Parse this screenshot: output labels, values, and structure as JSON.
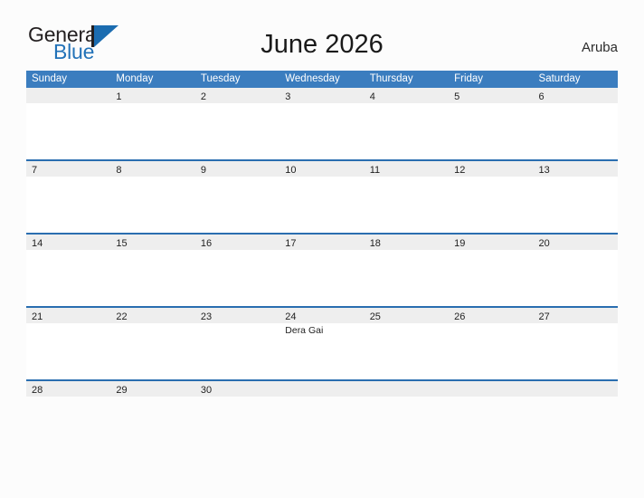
{
  "brand": {
    "name_part1": "General",
    "name_part2": "Blue",
    "mark": "triangle-logo-icon",
    "accent_color": "#1b6cb0"
  },
  "header": {
    "title": "June 2026",
    "region": "Aruba"
  },
  "calendar": {
    "month": "June",
    "year": "2026",
    "header_bg": "#3b7dbf",
    "row_divider_color": "#2a6eb0",
    "daynum_band_color": "#eeeeee",
    "weekdays": [
      "Sunday",
      "Monday",
      "Tuesday",
      "Wednesday",
      "Thursday",
      "Friday",
      "Saturday"
    ],
    "weeks": [
      [
        {
          "date": "",
          "event": ""
        },
        {
          "date": "1",
          "event": ""
        },
        {
          "date": "2",
          "event": ""
        },
        {
          "date": "3",
          "event": ""
        },
        {
          "date": "4",
          "event": ""
        },
        {
          "date": "5",
          "event": ""
        },
        {
          "date": "6",
          "event": ""
        }
      ],
      [
        {
          "date": "7",
          "event": ""
        },
        {
          "date": "8",
          "event": ""
        },
        {
          "date": "9",
          "event": ""
        },
        {
          "date": "10",
          "event": ""
        },
        {
          "date": "11",
          "event": ""
        },
        {
          "date": "12",
          "event": ""
        },
        {
          "date": "13",
          "event": ""
        }
      ],
      [
        {
          "date": "14",
          "event": ""
        },
        {
          "date": "15",
          "event": ""
        },
        {
          "date": "16",
          "event": ""
        },
        {
          "date": "17",
          "event": ""
        },
        {
          "date": "18",
          "event": ""
        },
        {
          "date": "19",
          "event": ""
        },
        {
          "date": "20",
          "event": ""
        }
      ],
      [
        {
          "date": "21",
          "event": ""
        },
        {
          "date": "22",
          "event": ""
        },
        {
          "date": "23",
          "event": ""
        },
        {
          "date": "24",
          "event": "Dera Gai"
        },
        {
          "date": "25",
          "event": ""
        },
        {
          "date": "26",
          "event": ""
        },
        {
          "date": "27",
          "event": ""
        }
      ],
      [
        {
          "date": "28",
          "event": ""
        },
        {
          "date": "29",
          "event": ""
        },
        {
          "date": "30",
          "event": ""
        },
        {
          "date": "",
          "event": ""
        },
        {
          "date": "",
          "event": ""
        },
        {
          "date": "",
          "event": ""
        },
        {
          "date": "",
          "event": ""
        }
      ]
    ]
  }
}
